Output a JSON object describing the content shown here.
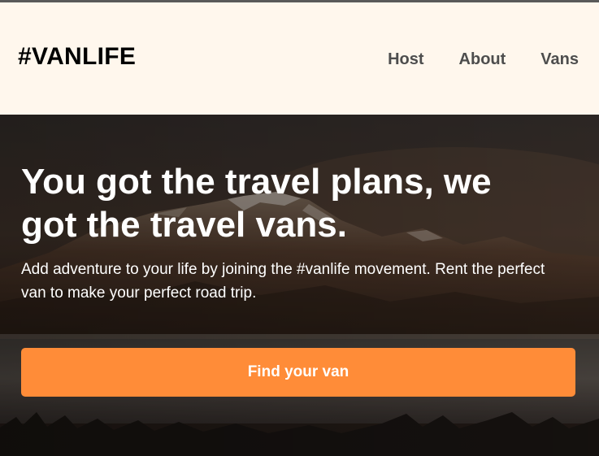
{
  "header": {
    "logo": "#VANLIFE",
    "nav": [
      {
        "label": "Host"
      },
      {
        "label": "About"
      },
      {
        "label": "Vans"
      }
    ]
  },
  "hero": {
    "title": "You got the travel plans, we got the travel vans.",
    "subtitle": "Add adventure to your life by joining the #vanlife movement. Rent the perfect van to make your perfect road trip.",
    "cta_label": "Find your van",
    "background": "mountain-lake-photo"
  },
  "colors": {
    "header_bg": "#FFF7ED",
    "nav_text": "#4D4D4D",
    "accent": "#FF8C38",
    "hero_text": "#FFFFFF"
  }
}
